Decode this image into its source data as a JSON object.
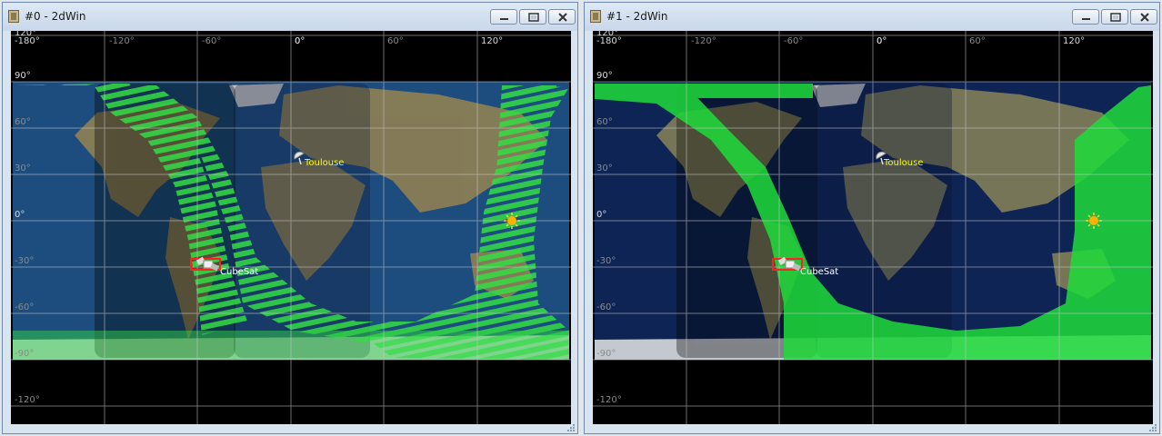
{
  "windows": [
    {
      "title": "#0 - 2dWin",
      "lon_ticks": [
        "-180°",
        "-120°",
        "-60°",
        "0°",
        "60°",
        "120°"
      ],
      "lat_ticks": [
        "120°",
        "90°",
        "60°",
        "30°",
        "0°",
        "-30°",
        "-60°",
        "-90°",
        "-120°"
      ],
      "ground_station": "Toulouse",
      "satellite": "CubeSat",
      "colors": {
        "label": "#ffff00",
        "swath": "#22e03a",
        "sat": "#ffffff"
      }
    },
    {
      "title": "#1 - 2dWin",
      "lon_ticks": [
        "-180°",
        "-120°",
        "-60°",
        "0°",
        "60°",
        "120°"
      ],
      "lat_ticks": [
        "120°",
        "90°",
        "60°",
        "30°",
        "0°",
        "-30°",
        "-60°",
        "-90°",
        "-120°"
      ],
      "ground_station": "Toulouse",
      "satellite": "CubeSat",
      "colors": {
        "label": "#ffff00",
        "swath": "#22e03a",
        "sat": "#ffffff"
      }
    }
  ],
  "icons": {
    "minimize": "minimize-icon",
    "maximize": "maximize-icon",
    "close": "close-icon",
    "sun": "sun-icon",
    "station": "satellite-dish-icon",
    "satellite": "satellite-icon"
  }
}
